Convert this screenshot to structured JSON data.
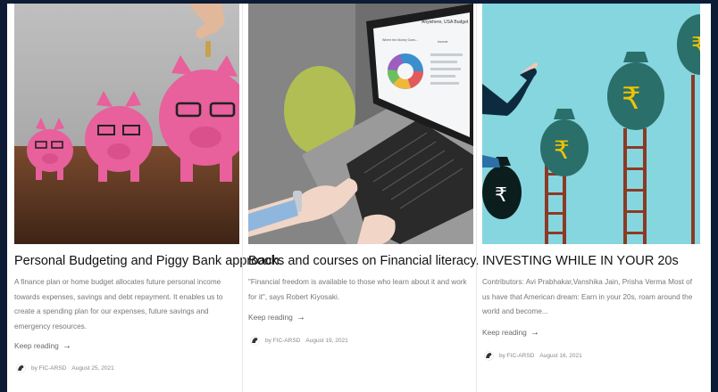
{
  "posts": [
    {
      "title": "Personal Budgeting and Piggy Bank approach.",
      "excerpt": "A finance plan or home budget allocates future personal income towards expenses, savings and debt repayment. It enables us to create a spending plan for our expenses, future savings and emergency resources.",
      "read_more": "Keep reading",
      "arrow": "→",
      "author": "by FIC-ARSD",
      "date": "August 25, 2021",
      "image": "piggy-banks-image"
    },
    {
      "title": "Books and courses on Financial literacy.",
      "excerpt": "\"Financial freedom is available to those who learn about it and work for it\", says Robert Kiyosaki.",
      "read_more": "Keep reading",
      "arrow": "→",
      "author": "by FIC-ARSD",
      "date": "August 19, 2021",
      "image": "laptop-dashboard-image",
      "screen_text": {
        "line1": "Anywhere, USA Budget",
        "line2": "Where the Money Goes...",
        "line3": "Income"
      }
    },
    {
      "title": "INVESTING WHILE IN YOUR 20s",
      "excerpt": "Contributors: Avi Prabhakar,Vanshika Jain, Prisha Verma Most of us have that American dream: Earn in your 20s, roam around the world and become...",
      "read_more": "Keep reading",
      "arrow": "→",
      "author": "by FIC-ARSD",
      "date": "August 16, 2021",
      "image": "rupee-bags-ladders-image",
      "rupee_symbol": "₹"
    }
  ],
  "colors": {
    "background": "#0d1b35",
    "panel": "#ffffff",
    "title": "#111111",
    "excerpt": "#777777",
    "piggy_pink": "#e8609c",
    "rupee_teal": "#2a6f6a",
    "rupee_gold": "#f2c200",
    "ladder_brown": "#8b3a25"
  }
}
